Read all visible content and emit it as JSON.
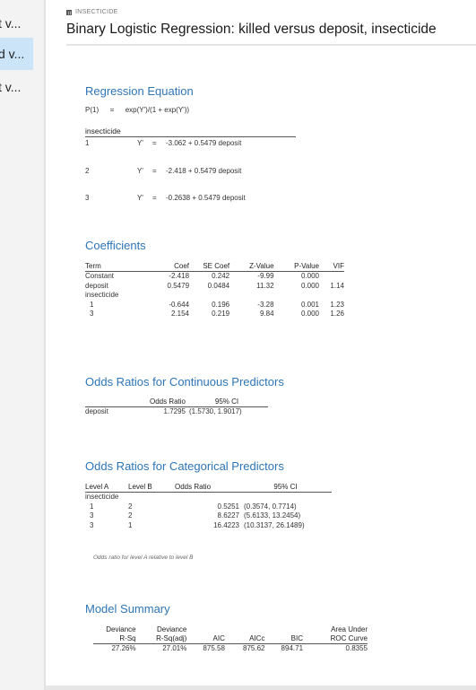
{
  "sidebar": {
    "items": [
      {
        "label": "t v...",
        "active": false
      },
      {
        "label": "d v...",
        "active": true
      },
      {
        "label": "t v...",
        "active": false
      }
    ]
  },
  "header": {
    "crumb_icon": "table-icon",
    "crumb": "INSECTICIDE",
    "title": "Binary Logistic Regression: killed versus deposit, insecticide"
  },
  "regression_equation": {
    "title": "Regression Equation",
    "formula_lhs": "P(1)",
    "formula_eq": "=",
    "formula_rhs": "exp(Y')/(1 + exp(Y'))",
    "group_header": "insecticide",
    "rows": [
      {
        "level": "1",
        "y": "Y'",
        "eq": "=",
        "expr": "-3.062 + 0.5479 deposit"
      },
      {
        "level": "2",
        "y": "Y'",
        "eq": "=",
        "expr": "-2.418 + 0.5479 deposit"
      },
      {
        "level": "3",
        "y": "Y'",
        "eq": "=",
        "expr": "-0.2638 + 0.5479 deposit"
      }
    ]
  },
  "coefficients": {
    "title": "Coefficients",
    "headers": [
      "Term",
      "Coef",
      "SE Coef",
      "Z-Value",
      "P-Value",
      "VIF"
    ],
    "rows": [
      [
        "Constant",
        "-2.418",
        "0.242",
        "-9.99",
        "0.000",
        ""
      ],
      [
        "deposit",
        "0.5479",
        "0.0484",
        "11.32",
        "0.000",
        "1.14"
      ],
      [
        "insecticide",
        "",
        "",
        "",
        "",
        ""
      ],
      [
        "1",
        "-0.644",
        "0.196",
        "-3.28",
        "0.001",
        "1.23"
      ],
      [
        "3",
        "2.154",
        "0.219",
        "9.84",
        "0.000",
        "1.26"
      ]
    ]
  },
  "odds_continuous": {
    "title": "Odds Ratios for Continuous Predictors",
    "headers": [
      "",
      "Odds Ratio",
      "95% CI"
    ],
    "rows": [
      [
        "deposit",
        "1.7295",
        "(1.5730, 1.9017)"
      ]
    ]
  },
  "odds_categorical": {
    "title": "Odds Ratios for Categorical Predictors",
    "headers": [
      "Level A",
      "Level B",
      "Odds Ratio",
      "95% CI"
    ],
    "group": "insecticide",
    "rows": [
      [
        "1",
        "2",
        "0.5251",
        "(0.3574, 0.7714)"
      ],
      [
        "3",
        "2",
        "8.6227",
        "(5.6133, 13.2454)"
      ],
      [
        "3",
        "1",
        "16.4223",
        "(10.3137, 26.1489)"
      ]
    ],
    "note": "Odds ratio for level A relative to level B"
  },
  "model_summary": {
    "title": "Model Summary",
    "headers_top": [
      "Deviance",
      "Deviance",
      "",
      "",
      "",
      "Area Under"
    ],
    "headers_bottom": [
      "R-Sq",
      "R-Sq(adj)",
      "AIC",
      "AICc",
      "BIC",
      "ROC Curve"
    ],
    "values": [
      "27.26%",
      "27.01%",
      "875.58",
      "875.62",
      "894.71",
      "0.8355"
    ]
  }
}
